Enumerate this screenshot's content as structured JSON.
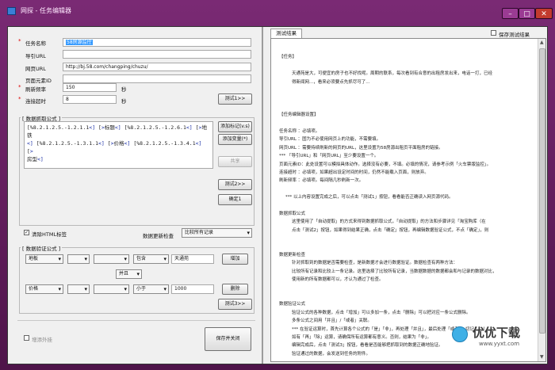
{
  "window": {
    "title": "网探 - 任务编辑器"
  },
  "form": {
    "task_name": {
      "label": "任务名称",
      "value": "58房源监控"
    },
    "nav_url": {
      "label": "导引URL",
      "value": ""
    },
    "page_url": {
      "label": "网页URL",
      "value": "http://bj.58.com/changping/chuzu/"
    },
    "page_element_id": {
      "label": "页面元素ID",
      "value": ""
    },
    "refresh_freq": {
      "label": "刷新频率",
      "value": "150",
      "unit": "秒"
    },
    "timeout": {
      "label": "连接超时",
      "value": "8",
      "unit": "秒"
    },
    "test1_button": "测试1>>"
  },
  "extract": {
    "title": "[ 数据抓取公式 ]",
    "formula_lines": [
      [
        "[%8.2.1.2.5.-1.2.1.1",
        {
          "v": "<]"
        },
        " [",
        {
          "v": ">"
        },
        "标题",
        {
          "v": "<]"
        },
        " [%8.2.1.2.5.-1.2.6.1",
        {
          "v": "<]"
        },
        " [",
        {
          "v": ">"
        },
        "地铁"
      ],
      [
        {
          "v": "<]"
        },
        " [%8.2.1.2.5.-1.3.1.1",
        {
          "v": "<]"
        },
        " [",
        {
          "v": ">"
        },
        "价格",
        {
          "v": "<]"
        },
        " [%8.2.1.2.5.-1.3.4.1",
        {
          "v": "<]"
        },
        " [",
        {
          "v": ">"
        }
      ],
      [
        "房型",
        {
          "v": "<]"
        }
      ]
    ],
    "btn_mark": "添加标记(v.s)",
    "btn_var": "添加变量(*)",
    "btn_share": "共享",
    "btn_test2": "测试2>>",
    "btn_confirm": "确定1"
  },
  "options": {
    "strip_html_label": "清除HTML标签",
    "strip_html_checked": true,
    "update_check_label": "数据更新检查",
    "update_check_value": "比较所有记录"
  },
  "verify": {
    "title": "[ 数据验证公式 ]",
    "row1": {
      "field": "地板",
      "op2": "",
      "op3": "",
      "relation": "包含",
      "value": "天通苑",
      "button": "增加"
    },
    "join": "并且",
    "row2": {
      "field": "价格",
      "op2": "",
      "op3": "",
      "relation": "小于",
      "value": "1000",
      "button": "删除"
    },
    "btn_test3": "测试3>>"
  },
  "bottom": {
    "external_check_label": "增添外挂",
    "save_close": "保存并关闭"
  },
  "right_panel": {
    "tab_label": "测试结果",
    "save_test_result_label": "保存测试结果",
    "doc_lines": [
      {
        "t": "",
        "i": 0
      },
      {
        "t": "【任务】",
        "i": 0
      },
      {
        "t": "",
        "i": 0
      },
      {
        "t": "天通苑是大，可便宜的房子也不好找呢。周期的联系，每次看到有合意的出租房发出来，电话一打，已经",
        "i": 4
      },
      {
        "t": "得新闻网...，看来必须要点先抓尽可了...",
        "i": 4
      },
      {
        "t": "",
        "i": 0
      },
      {
        "t": "",
        "i": 0
      },
      {
        "t": "",
        "i": 0
      },
      {
        "t": "【任务编辑器设置】",
        "i": 0
      },
      {
        "t": "",
        "i": 0
      },
      {
        "t": "任务名称    ：必填项。",
        "i": 0
      },
      {
        "t": "导引URL       ：固为不必使用网页上的功能，不需要填。",
        "i": 0
      },
      {
        "t": "网页URL       ：需要持续刷新的网页的URL，这里设置为58房源出租页平面租房的链接。",
        "i": 0
      },
      {
        "t": "            *** 「导引URL」和「网页URL」至少要设置一个。",
        "i": 0
      },
      {
        "t": "页面元素ID：此处设置可以模拟具体动作。选择没有必要，不填。必填的情况，请参考示例「火车票版监控」。",
        "i": 0
      },
      {
        "t": "连接超时    ：必填项，如果超出设定时间的时间，仍然不能载入页面，则放弃。",
        "i": 0
      },
      {
        "t": "刷新频率    ：必填项。每间隔几秒刷新一次。",
        "i": 0
      },
      {
        "t": "",
        "i": 0
      },
      {
        "t": "*** 以上内容设置完成之后，可以点击「测试1」按钮，看看能否正确读入网页源代码。",
        "i": 2
      },
      {
        "t": "",
        "i": 0
      },
      {
        "t": "数据抓取公式",
        "i": 0
      },
      {
        "t": "这里使用了「自动提取」的方式来得到数据抓取公式，「自动提取」的方法和步骤详见「淘宝购库（在",
        "i": 4
      },
      {
        "t": "点击「测试2」按钮，如果得到结果正确，点击「确定」按钮，再编辑数据验证公式，不点「确定」，则",
        "i": 4
      },
      {
        "t": "",
        "i": 0
      },
      {
        "t": "",
        "i": 0
      },
      {
        "t": "数据更新检查",
        "i": 0
      },
      {
        "t": "针对抓取到的数据是否需要检查，是新数据才会进行数据验证。数据检查有两种方法：",
        "i": 4
      },
      {
        "t": "比较所有记录和比较上一条记录。这里选择了比较所有记录，当数据数据的数据都会和与记录的数据对比，",
        "i": 4
      },
      {
        "t": "使用新的所有数据都可以，才认为通过了检查。",
        "i": 4
      },
      {
        "t": "",
        "i": 0
      },
      {
        "t": "",
        "i": 0
      },
      {
        "t": "数据验证公式",
        "i": 0
      },
      {
        "t": "验证公式的各种数据，点击「增加」可以多加一条，点击「删除」可以把对应一条公式删除。",
        "i": 4
      },
      {
        "t": "多条公式之间用「并且」/「或者」关联。",
        "i": 4
      },
      {
        "t": "*** 在验证运算时，首先计算各个公式的「是」「非」，再处理「并且」，最后处理「或者」，切记！！！",
        "i": 4
      },
      {
        "t": "如有「再」「除」运算，请确保所有运算都有意义。否则，结果为「非」。",
        "i": 4
      },
      {
        "t": "编辑完成后，点击「测试3」按钮，看看是否能够把抓取到的数据正确地验证。",
        "i": 4
      },
      {
        "t": "验证通过的数据，会发送到任务的附件。",
        "i": 4
      }
    ]
  },
  "watermark": {
    "brand": "优优下载",
    "url": "www.yyxt.com"
  },
  "colors": {
    "frame": "#6a1f64",
    "close": "#c23b2e",
    "selection": "#3399ff",
    "code_var": "#1a2fa6",
    "required": "#dd0000"
  }
}
